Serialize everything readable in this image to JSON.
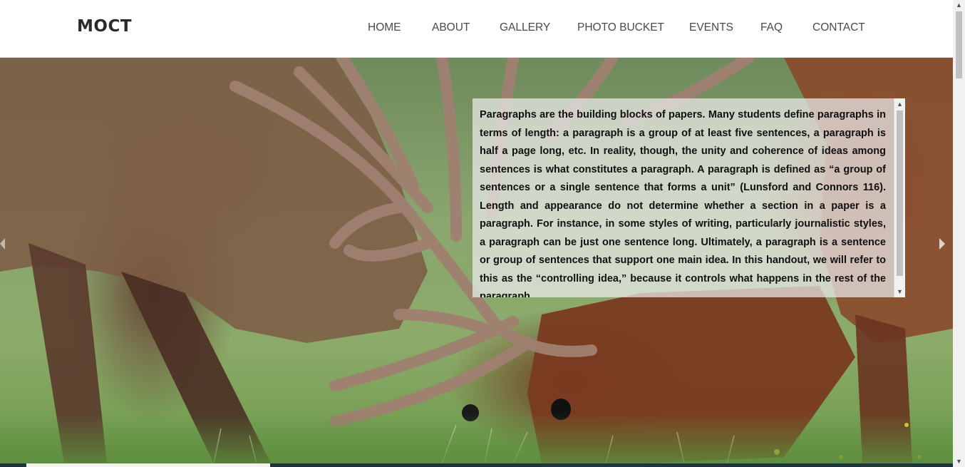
{
  "header": {
    "logo": "MOCT",
    "nav": [
      {
        "label": "HOME"
      },
      {
        "label": "ABOUT"
      },
      {
        "label": "GALLERY"
      },
      {
        "label": "PHOTO BUCKET"
      },
      {
        "label": "EVENTS"
      },
      {
        "label": "FAQ"
      },
      {
        "label": "CONTACT"
      }
    ]
  },
  "hero": {
    "image": "elk-sparring-photo",
    "prev_icon": "chevron-left-icon",
    "next_icon": "chevron-right-icon",
    "text": "Paragraphs are the building blocks of papers. Many students define paragraphs in terms of length: a paragraph is a group of at least five sentences, a paragraph is half a page long, etc. In reality, though, the unity and coherence of ideas among sentences is what constitutes a paragraph. A paragraph is defined as “a group of sentences or a single sentence that forms a unit” (Lunsford and Connors 116). Length and appearance do not determine whether a section in a paper is a paragraph. For instance, in some styles of writing, particularly journalistic styles, a paragraph can be just one sentence long. Ultimately, a paragraph is a sentence or group of sentences that support one main idea. In this handout, we will refer to this as the “controlling idea,” because it controls what happens in the rest of the paragraph."
  },
  "scrollbar": {
    "up": "▲",
    "down": "▼"
  },
  "colors": {
    "header_bg": "#ffffff",
    "nav_text": "#4a4a4a",
    "logo_text": "#2b2b2b",
    "panel_bg": "#ebebeb",
    "bottom_strip": "#1f3340"
  }
}
